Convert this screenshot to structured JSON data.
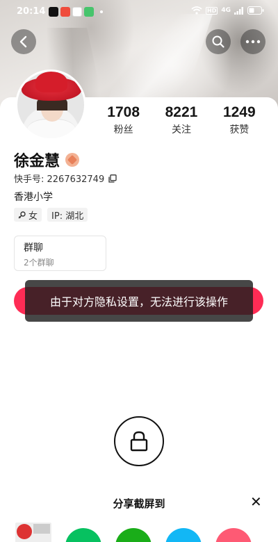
{
  "status_bar": {
    "time": "20:14",
    "signal": "4G",
    "hd": "HD"
  },
  "profile": {
    "stats": [
      {
        "value": "1708",
        "label": "粉丝"
      },
      {
        "value": "8221",
        "label": "关注"
      },
      {
        "value": "1249",
        "label": "获赞"
      }
    ],
    "name": "徐金慧",
    "uid_label": "快手号: 2267632749",
    "bio": "香港小学",
    "tags": [
      {
        "label": "女",
        "icon": "female-icon"
      },
      {
        "label": "IP: 湖北"
      }
    ],
    "group": {
      "title": "群聊",
      "subtitle": "2个群聊"
    }
  },
  "toast": {
    "message": "由于对方隐私设置，无法进行该操作"
  },
  "share_sheet": {
    "title": "分享截屏到",
    "close": "✕"
  },
  "colors": {
    "accent": "#fe2c55",
    "toast_bg": "#1e1e1e"
  }
}
